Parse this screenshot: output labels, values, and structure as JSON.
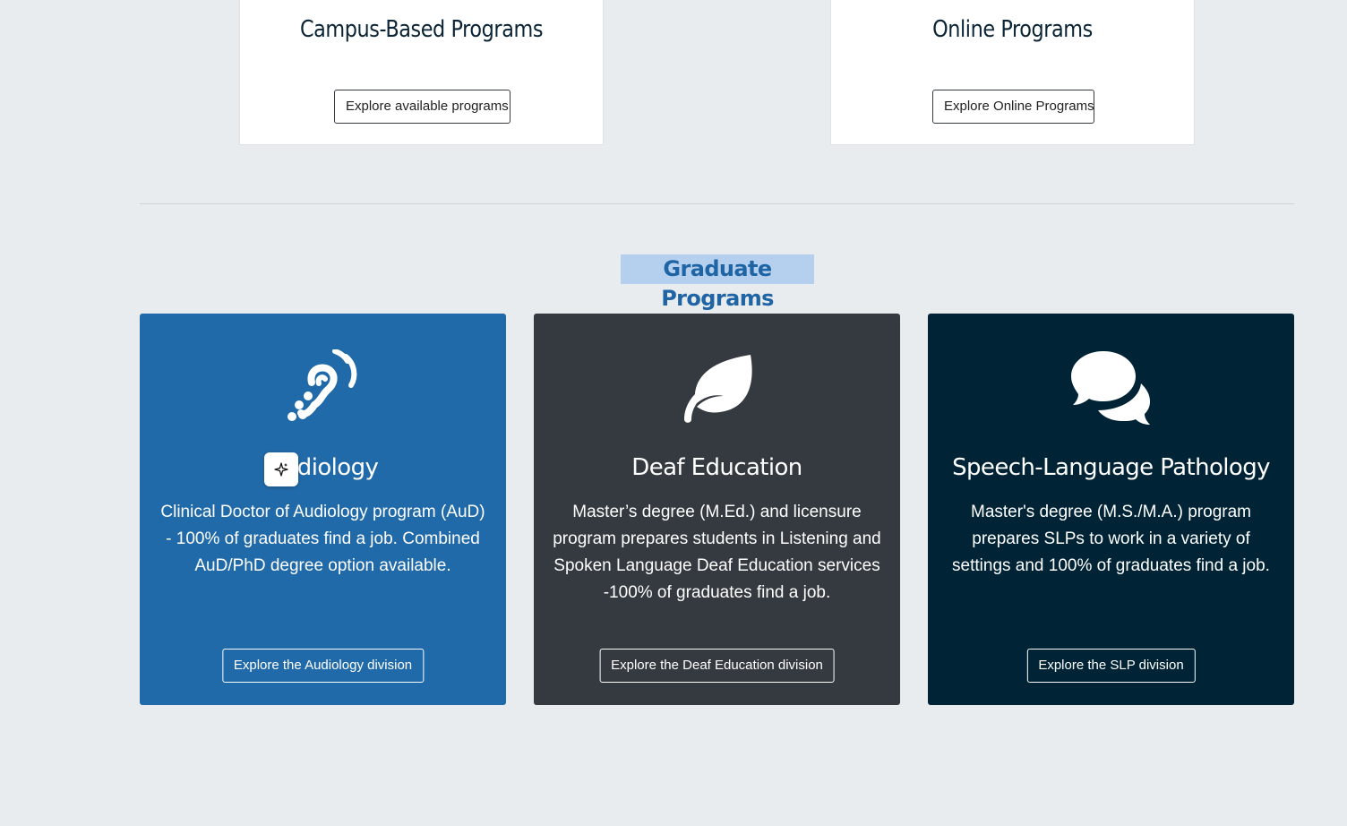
{
  "top_cards": {
    "campus": {
      "title": "Campus-Based Programs",
      "button": "Explore available programs"
    },
    "online": {
      "title": "Online Programs",
      "button": "Explore Online Programs"
    }
  },
  "graduate": {
    "title": "Graduate Programs",
    "cards": [
      {
        "title": "Audiology",
        "icon": "assistive-listening-icon",
        "color": "#216aa9",
        "description": "Clinical Doctor of Audiology program (AuD) - 100% of graduates find a job. Combined AuD/PhD degree option available.",
        "button": "Explore the Audiology division"
      },
      {
        "title": "Deaf Education",
        "icon": "leaf-icon",
        "color": "#343a40",
        "description": "Master’s degree (M.Ed.) and licensure program prepares students in Listening and Spoken Language Deaf Education services -100% of graduates find a job.",
        "button": "Explore the Deaf Education division"
      },
      {
        "title": "Speech-Language Pathology",
        "icon": "comments-icon",
        "color": "#002436",
        "description": "Master's degree (M.S./M.A.) program prepares SLPs to work in a variety of settings and 100% of graduates find a job.",
        "button": "Explore the SLP division"
      }
    ]
  },
  "overlay": {
    "icon": "sparkle-icon"
  }
}
